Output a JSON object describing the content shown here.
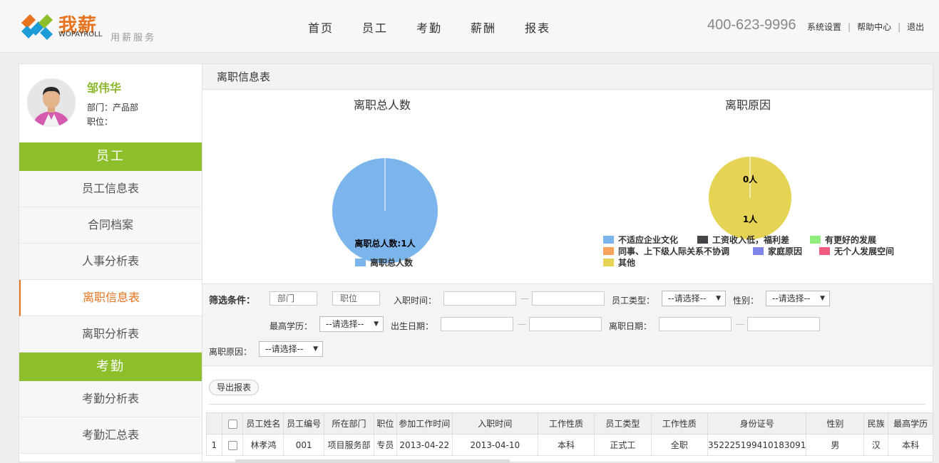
{
  "header": {
    "logo_cn": "我薪",
    "logo_en": "WOPAYROLL",
    "logo_sub": "用薪服务",
    "nav": [
      "首页",
      "员工",
      "考勤",
      "薪酬",
      "报表"
    ],
    "phone": "400-623-9996",
    "links": [
      "系统设置",
      "帮助中心",
      "退出"
    ]
  },
  "profile": {
    "name": "邹伟华",
    "dept": "部门：产品部",
    "position": "职位："
  },
  "sidebar": {
    "section1": "员工",
    "items1": [
      "员工信息表",
      "合同档案",
      "人事分析表",
      "离职信息表",
      "离职分析表"
    ],
    "section2": "考勤",
    "items2": [
      "考勤分析表",
      "考勤汇总表"
    ]
  },
  "main": {
    "title": "离职信息表"
  },
  "chart_data": [
    {
      "type": "pie",
      "title": "离职总人数",
      "labels": [
        "离职总人数"
      ],
      "values": [
        1
      ],
      "data_labels": [
        "离职总人数:1人"
      ],
      "colors": [
        "#7cb5ec"
      ],
      "legend": [
        "离职总人数"
      ],
      "legend_position": "bottom"
    },
    {
      "type": "pie",
      "title": "离职原因",
      "labels": [
        "不适应企业文化",
        "工资收入低，福利差",
        "有更好的发展",
        "同事、上下级人际关系不协调",
        "家庭原因",
        "无个人发展空间",
        "其他"
      ],
      "values": [
        0,
        0,
        0,
        0,
        0,
        0,
        1
      ],
      "data_labels": [
        "0人",
        "1人"
      ],
      "colors": [
        "#7cb5ec",
        "#434348",
        "#90ed7d",
        "#f7a35c",
        "#8085e9",
        "#f15c80",
        "#e4d354"
      ],
      "legend_position": "bottom"
    }
  ],
  "filter": {
    "title": "筛选条件：",
    "dept_placeholder": "部门",
    "position_placeholder": "职位",
    "join_time": "入职时间：",
    "emp_type": "员工类型：",
    "gender": "性别：",
    "education": "最高学历：",
    "birth_date": "出生日期：",
    "leave_date": "离职日期：",
    "leave_reason": "离职原因：",
    "select_default": "--请选择--",
    "dash": "—"
  },
  "export_label": "导出报表",
  "table": {
    "headers": [
      "",
      "员工姓名",
      "员工编号",
      "所在部门",
      "职位",
      "参加工作时间",
      "入职时间",
      "工作性质",
      "员工类型",
      "工作性质",
      "身份证号",
      "性别",
      "民族",
      "最高学历"
    ],
    "rows": [
      [
        "1",
        "林孝鸿",
        "001",
        "项目服务部",
        "专员",
        "2013-04-22",
        "2013-04-10",
        "本科",
        "正式工",
        "全职",
        "352225199410183091",
        "男",
        "汉",
        "本科"
      ]
    ]
  }
}
